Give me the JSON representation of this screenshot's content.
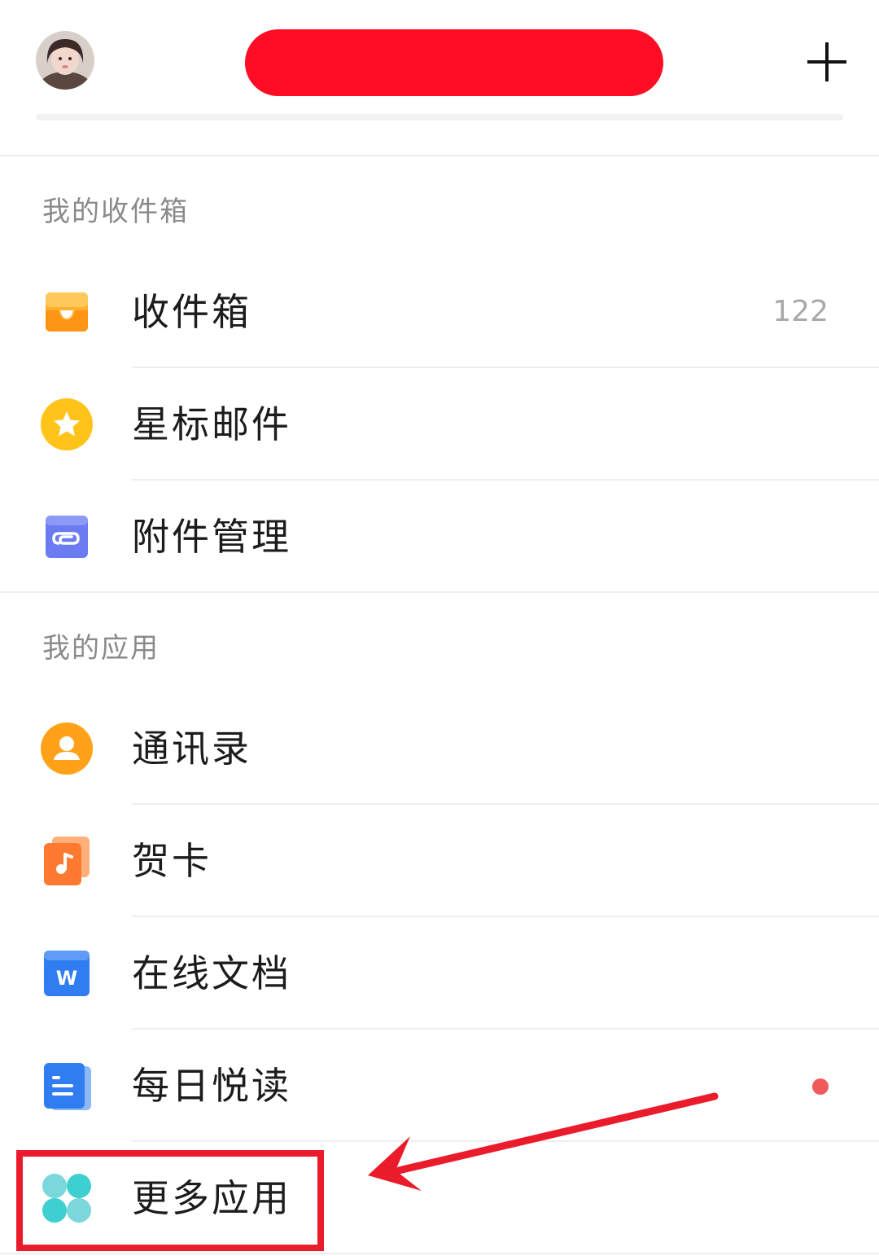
{
  "sections": {
    "inbox_title": "我的收件箱",
    "apps_title": "我的应用"
  },
  "mailbox_items": [
    {
      "icon": "inbox-icon",
      "label": "收件箱",
      "count": "122"
    },
    {
      "icon": "star-icon",
      "label": "星标邮件"
    },
    {
      "icon": "attachment-icon",
      "label": "附件管理"
    }
  ],
  "app_items": [
    {
      "icon": "contacts-icon",
      "label": "通讯录"
    },
    {
      "icon": "greeting-card-icon",
      "label": "贺卡"
    },
    {
      "icon": "word-document-icon",
      "label": "在线文档"
    },
    {
      "icon": "daily-reading-icon",
      "label": "每日悦读",
      "badge": "unread-dot"
    },
    {
      "icon": "more-apps-icon",
      "label": "更多应用"
    }
  ],
  "header": {
    "avatar_icon": "user-avatar",
    "add_icon": "plus-icon"
  },
  "colors": {
    "redaction": "#fe0d24",
    "annotation": "#ea1c2c",
    "inbox": "#ffa21a",
    "star": "#ffc31a",
    "attachment": "#6b7cf2",
    "contacts": "#ffa21a",
    "greeting_card": "#ff7a30",
    "document": "#2f7df0",
    "more_apps": "#3ecfd1"
  }
}
